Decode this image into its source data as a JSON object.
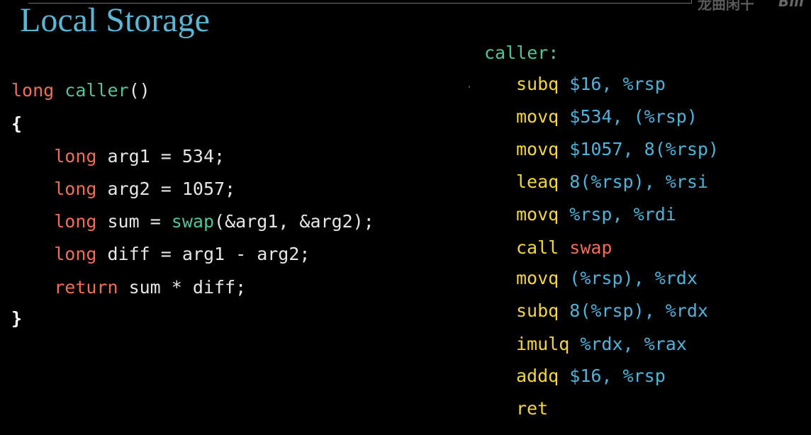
{
  "watermark": {
    "text": "龙曲闲干",
    "logo": "Bili"
  },
  "title": "Local Storage",
  "c_code": [
    {
      "tokens": [
        [
          "kw",
          "long"
        ],
        [
          "plain",
          " "
        ],
        [
          "fn",
          "caller"
        ],
        [
          "plain",
          "()"
        ]
      ]
    },
    {
      "tokens": [
        [
          "brace",
          "{"
        ]
      ]
    },
    {
      "tokens": [
        [
          "plain",
          "    "
        ],
        [
          "kw",
          "long"
        ],
        [
          "plain",
          " arg1 = 534;"
        ]
      ]
    },
    {
      "tokens": [
        [
          "plain",
          "    "
        ],
        [
          "kw",
          "long"
        ],
        [
          "plain",
          " arg2 = 1057;"
        ]
      ]
    },
    {
      "tokens": [
        [
          "plain",
          "    "
        ],
        [
          "kw",
          "long"
        ],
        [
          "plain",
          " sum = "
        ],
        [
          "fn",
          "swap"
        ],
        [
          "plain",
          "(&arg1, &arg2);"
        ]
      ]
    },
    {
      "tokens": [
        [
          "plain",
          "    "
        ],
        [
          "kw",
          "long"
        ],
        [
          "plain",
          " diff = arg1 - arg2;"
        ]
      ]
    },
    {
      "tokens": [
        [
          "plain",
          "    "
        ],
        [
          "kw",
          "return"
        ],
        [
          "plain",
          " sum * diff;"
        ]
      ]
    },
    {
      "tokens": [
        [
          "brace",
          "}"
        ]
      ]
    }
  ],
  "asm_label": "caller:",
  "asm": [
    {
      "instr": "subq",
      "sp": " ",
      "ops": "$16, %rsp"
    },
    {
      "instr": "movq",
      "sp": " ",
      "ops": "$534, (%rsp)"
    },
    {
      "instr": "movq",
      "sp": " ",
      "ops": "$1057, 8(%rsp)"
    },
    {
      "instr": "leaq",
      "sp": " ",
      "ops": "8(%rsp), %rsi"
    },
    {
      "instr": "movq",
      "sp": " ",
      "ops": "%rsp, %rdi"
    },
    {
      "instr": "call",
      "sp": " ",
      "ops": "swap",
      "ops_kind": "call"
    },
    {
      "instr": "movq",
      "sp": " ",
      "ops": "(%rsp), %rdx"
    },
    {
      "instr": "subq",
      "sp": " ",
      "ops": "8(%rsp), %rdx"
    },
    {
      "instr": "imulq",
      "sp": " ",
      "ops": "%rdx, %rax"
    },
    {
      "instr": "addq",
      "sp": " ",
      "ops": "$16, %rsp"
    },
    {
      "instr": "ret",
      "sp": "",
      "ops": ""
    }
  ]
}
